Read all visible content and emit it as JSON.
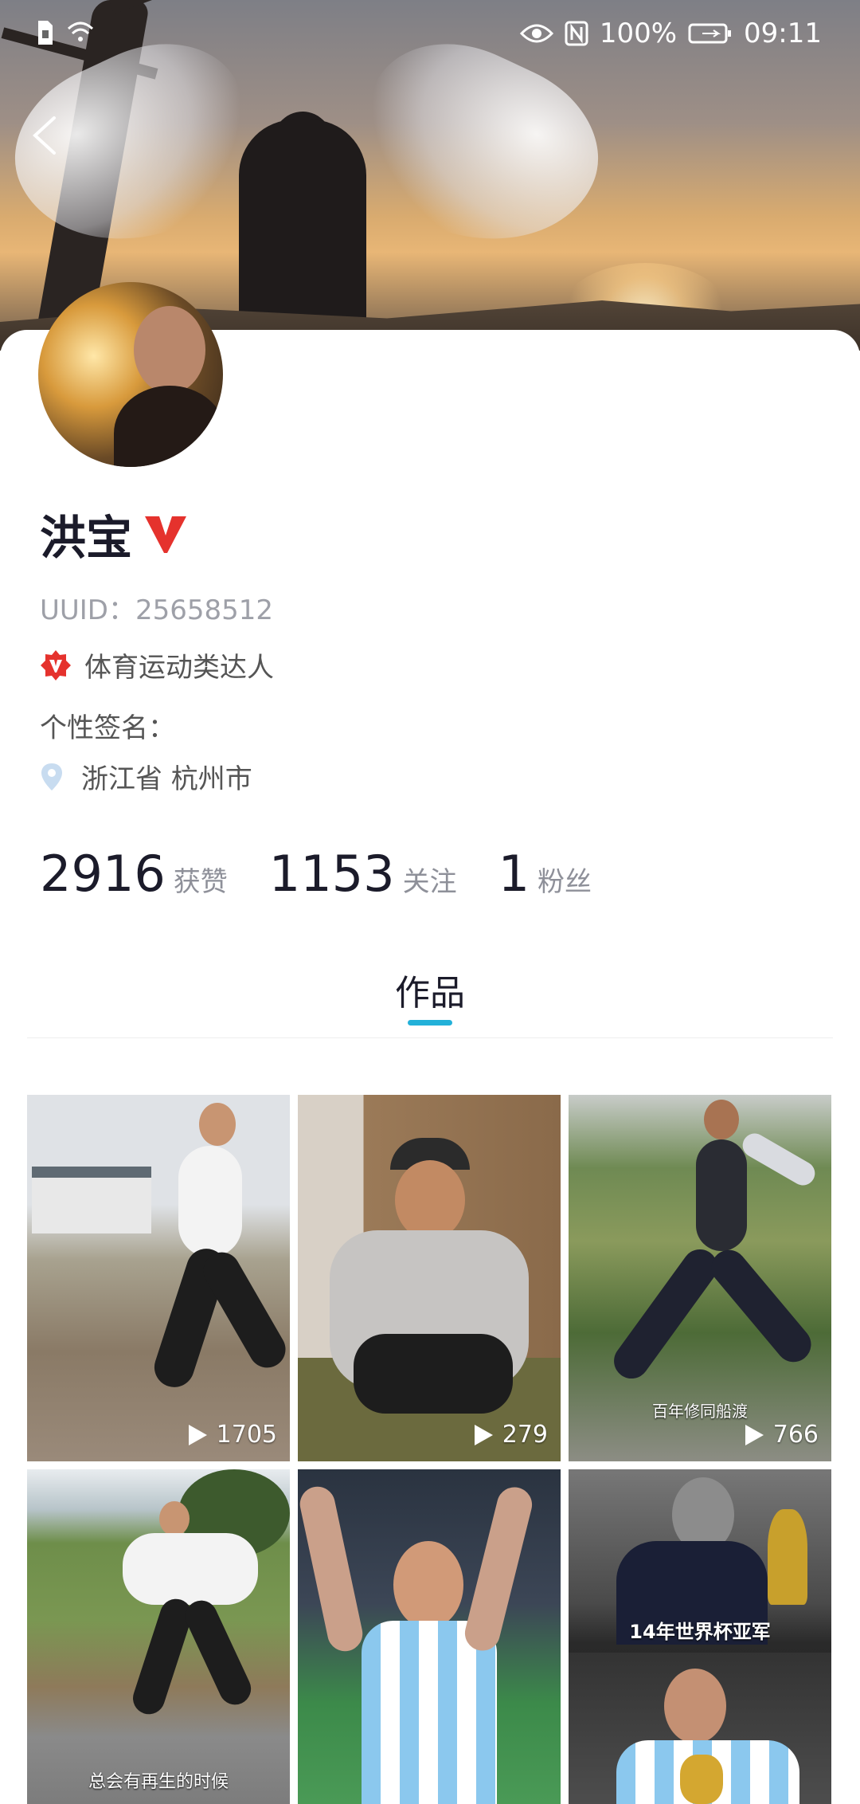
{
  "status": {
    "battery": "100%",
    "time": "09:11"
  },
  "profile": {
    "name": "洪宝",
    "uuid": "UUID：25658512",
    "tag": "体育运动类达人",
    "signature": "个性签名：",
    "location": "浙江省  杭州市"
  },
  "stats": [
    {
      "num": "2916",
      "label": "获赞"
    },
    {
      "num": "1153",
      "label": "关注"
    },
    {
      "num": "1",
      "label": "粉丝"
    }
  ],
  "tabs": [
    {
      "label": "作品"
    }
  ],
  "videos": [
    {
      "plays": "1705",
      "caption": ""
    },
    {
      "plays": "279",
      "caption": ""
    },
    {
      "plays": "766",
      "caption": "百年修同船渡"
    },
    {
      "plays": "",
      "caption": "总会有再生的时候"
    },
    {
      "plays": "",
      "caption": ""
    },
    {
      "plays": "",
      "caption": "14年世界杯亚军"
    }
  ],
  "colors": {
    "accent": "#23b1d9",
    "verified": "#e5322d"
  }
}
